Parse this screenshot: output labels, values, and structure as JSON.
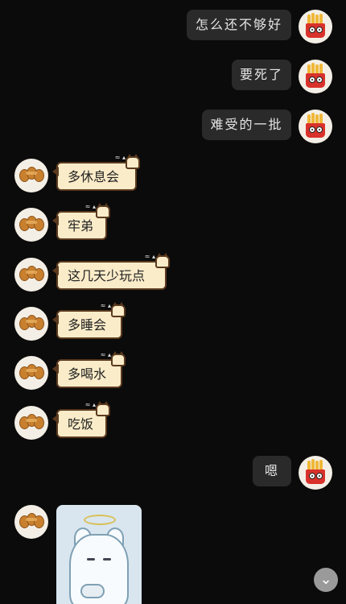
{
  "messages": [
    {
      "side": "right",
      "text": "怎么还不够好"
    },
    {
      "side": "right",
      "text": "要死了"
    },
    {
      "side": "right",
      "text": "难受的一批"
    },
    {
      "side": "left",
      "text": "多休息会"
    },
    {
      "side": "left",
      "text": "牢弟"
    },
    {
      "side": "left",
      "text": "这几天少玩点"
    },
    {
      "side": "left",
      "text": "多睡会"
    },
    {
      "side": "left",
      "text": "多喝水"
    },
    {
      "side": "left",
      "text": "吃饭"
    },
    {
      "side": "right",
      "text": "嗯"
    }
  ],
  "icons": {
    "self_avatar": "fries-avatar",
    "friend_avatar": "croissant-avatar",
    "sticker": "angel-dog-sticker",
    "scroll": "chevron-down-icon"
  },
  "scroll_button": {
    "glyph": "⌄"
  },
  "colors": {
    "background": "#0b0b0b",
    "right_bubble": "#2a2a2a",
    "left_bubble": "#fbecc9"
  }
}
